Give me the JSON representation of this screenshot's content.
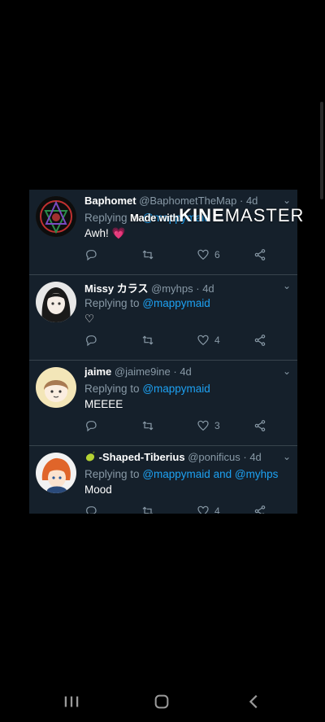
{
  "tweets": [
    {
      "name": "Baphomet",
      "handle": "@BaphometTheMap",
      "sep": "·",
      "age": "4d",
      "replying_prefix": "Replying to",
      "mention1": "@mappymaid",
      "mention_joiner": "",
      "mention2": "",
      "text": "Awh! ",
      "emoji": "💗",
      "likes": "6",
      "avatar": "baphomet-avatar"
    },
    {
      "name": "Missy カラス",
      "handle": "@myhps",
      "sep": "·",
      "age": "4d",
      "replying_prefix": "Replying to",
      "mention1": "@mappymaid",
      "mention_joiner": "",
      "mention2": "",
      "text": "♡",
      "likes": "4",
      "avatar": "anime-girl-avatar"
    },
    {
      "name": "jaime",
      "handle": "@jaime9ine",
      "sep": "·",
      "age": "4d",
      "replying_prefix": "Replying to",
      "mention1": "@mappymaid",
      "mention_joiner": "",
      "mention2": "",
      "text": "MEEEE",
      "likes": "3",
      "avatar": "chibi-avatar"
    },
    {
      "name": "-Shaped-Tiberius",
      "handle": "@ponificus",
      "sep": "·",
      "age": "4d",
      "replying_prefix": "Replying to",
      "mention1": "@mappymaid",
      "mention_joiner": "and",
      "mention2": "@myhps",
      "text": "Mood",
      "likes": "4",
      "avatar": "orange-hair-avatar"
    }
  ],
  "watermark": {
    "prefix": "Made with",
    "brand_bold": "KINE",
    "brand_rest": "MASTER"
  },
  "colors": {
    "panel_bg": "#15202b",
    "mention": "#1da1f2",
    "muted": "#8899a6",
    "heart": "#e0245e"
  },
  "icons": [
    "reply-icon",
    "retweet-icon",
    "heart-icon",
    "share-icon",
    "chevron-down-icon"
  ],
  "navbar": {
    "buttons": [
      "recents",
      "home",
      "back"
    ]
  }
}
